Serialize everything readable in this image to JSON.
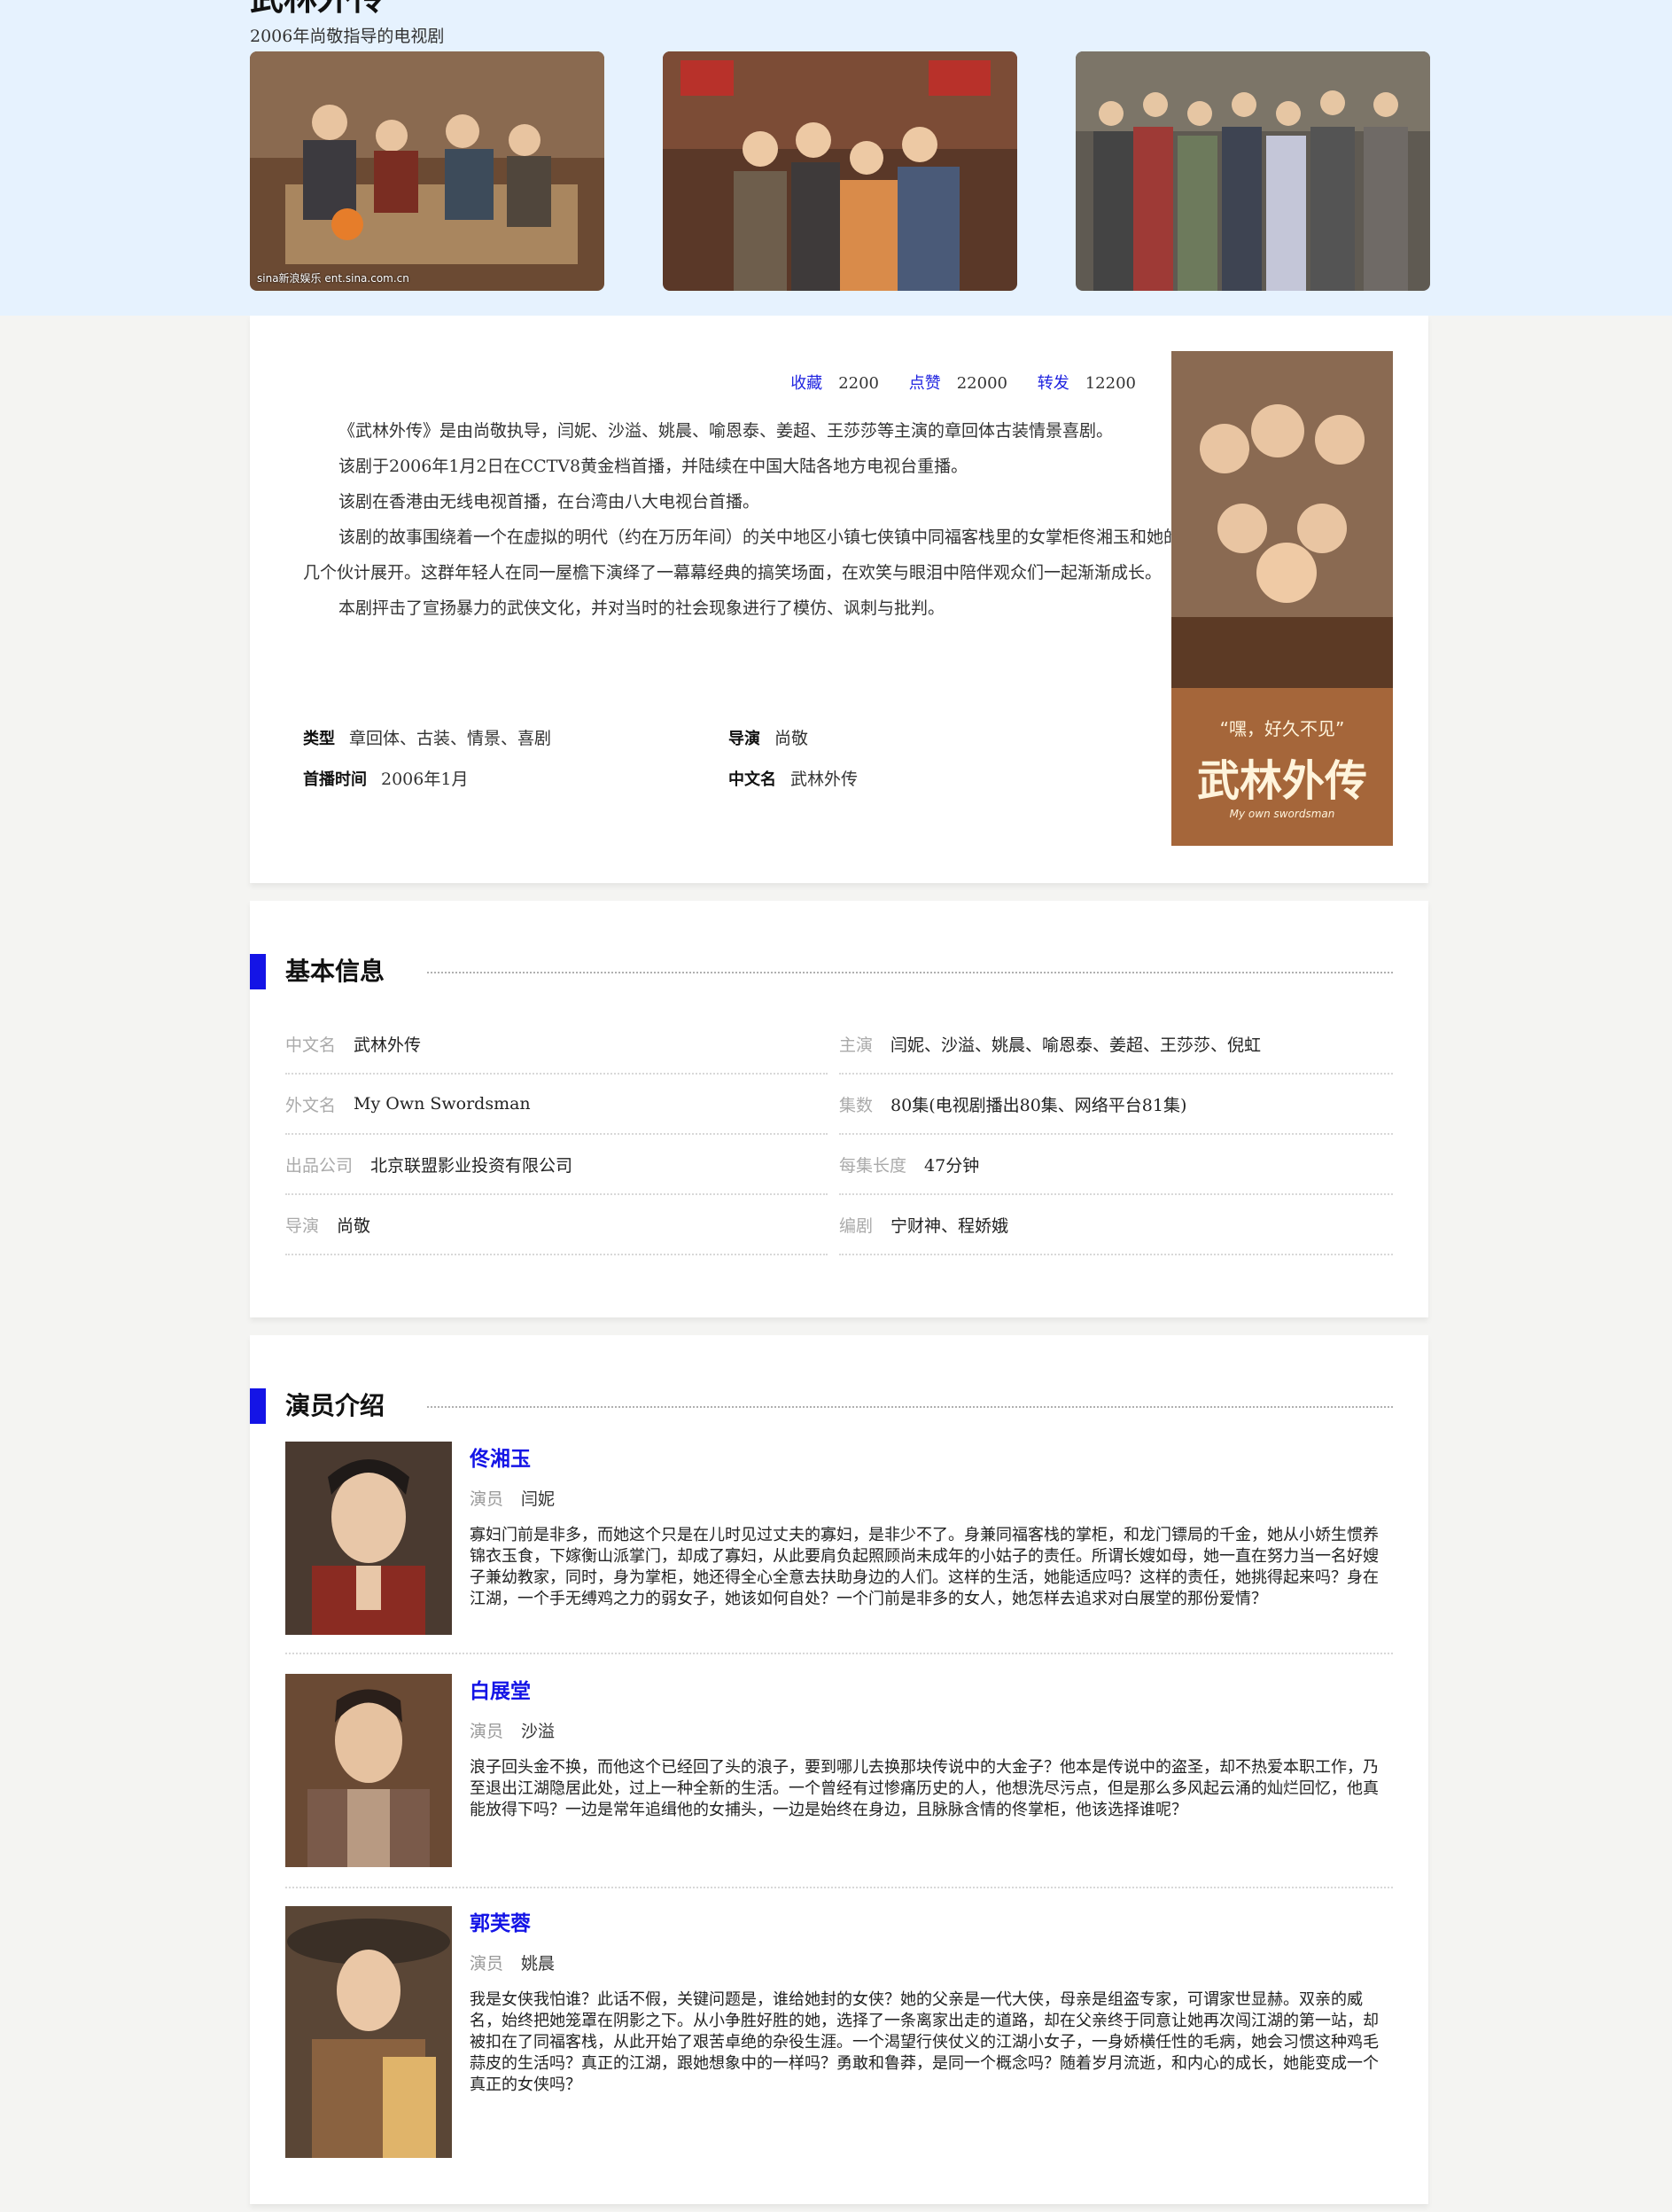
{
  "hero": {
    "title": "武林外传",
    "subtitle": "2006年尚敬指导的电视剧",
    "images": [
      {
        "caption": "sina新浪娱乐 ent.sina.com.cn"
      },
      {
        "caption": ""
      },
      {
        "caption": ""
      }
    ]
  },
  "summary": {
    "stats": [
      {
        "label": "收藏",
        "value": "2200"
      },
      {
        "label": "点赞",
        "value": "22000"
      },
      {
        "label": "转发",
        "value": "12200"
      }
    ],
    "paragraphs": [
      "《武林外传》是由尚敬执导，闫妮、沙溢、姚晨、喻恩泰、姜超、王莎莎等主演的章回体古装情景喜剧。",
      "该剧于2006年1月2日在CCTV8黄金档首播，并陆续在中国大陆各地方电视台重播。",
      "该剧在香港由无线电视首播，在台湾由八大电视台首播。",
      "该剧的故事围绕着一个在虚拟的明代（约在万历年间）的关中地区小镇七侠镇中同福客栈里的女掌柜佟湘玉和她的几个伙计展开。这群年轻人在同一屋檐下演绎了一幕幕经典的搞笑场面，在欢笑与眼泪中陪伴观众们一起渐渐成长。",
      "本剧抨击了宣扬暴力的武侠文化，并对当时的社会现象进行了模仿、讽刺与批判。"
    ],
    "facts": [
      {
        "key": "类型",
        "value": "章回体、古装、情景、喜剧"
      },
      {
        "key": "导演",
        "value": "尚敬"
      },
      {
        "key": "首播时间",
        "value": "2006年1月"
      },
      {
        "key": "中文名",
        "value": "武林外传"
      }
    ],
    "poster": {
      "tagline": "“嘿，好久不见”",
      "logo": "武林外传",
      "logo_en": "My own swordsman"
    }
  },
  "basic_info": {
    "title": "基本信息",
    "rows": [
      {
        "key": "中文名",
        "value": "武林外传"
      },
      {
        "key": "主演",
        "value": "闫妮、沙溢、姚晨、喻恩泰、姜超、王莎莎、倪虹"
      },
      {
        "key": "外文名",
        "value": "My Own Swordsman"
      },
      {
        "key": "集数",
        "value": "80集(电视剧播出80集、网络平台81集)"
      },
      {
        "key": "出品公司",
        "value": "北京联盟影业投资有限公司"
      },
      {
        "key": "每集长度",
        "value": "47分钟"
      },
      {
        "key": "导演",
        "value": "尚敬"
      },
      {
        "key": "编剧",
        "value": "宁财神、程娇娥"
      }
    ]
  },
  "cast": {
    "title": "演员介绍",
    "role_label": "演员",
    "actors": [
      {
        "character": "佟湘玉",
        "actor": "闫妮",
        "description": "寡妇门前是非多，而她这个只是在儿时见过丈夫的寡妇，是非少不了。身兼同福客栈的掌柜，和龙门镖局的千金，她从小娇生惯养锦衣玉食，下嫁衡山派掌门，却成了寡妇，从此要肩负起照顾尚未成年的小姑子的责任。所谓长嫂如母，她一直在努力当一名好嫂子兼幼教家，同时，身为掌柜，她还得全心全意去扶助身边的人们。这样的生活，她能适应吗？这样的责任，她挑得起来吗？身在江湖，一个手无缚鸡之力的弱女子，她该如何自处？一个门前是非多的女人，她怎样去追求对白展堂的那份爱情？"
      },
      {
        "character": "白展堂",
        "actor": "沙溢",
        "description": "浪子回头金不换，而他这个已经回了头的浪子，要到哪儿去换那块传说中的大金子？他本是传说中的盗圣，却不热爱本职工作，乃至退出江湖隐居此处，过上一种全新的生活。一个曾经有过惨痛历史的人，他想洗尽污点，但是那么多风起云涌的灿烂回忆，他真能放得下吗？一边是常年追缉他的女捕头，一边是始终在身边，且脉脉含情的佟掌柜，他该选择谁呢？"
      },
      {
        "character": "郭芙蓉",
        "actor": "姚晨",
        "description": "我是女侠我怕谁？此话不假，关键问题是，谁给她封的女侠？她的父亲是一代大侠，母亲是组盗专家，可谓家世显赫。双亲的威名，始终把她笼罩在阴影之下。从小争胜好胜的她，选择了一条离家出走的道路，却在父亲终于同意让她再次闯江湖的第一站，却被扣在了同福客栈，从此开始了艰苦卓绝的杂役生涯。一个渴望行侠仗义的江湖小女子，一身娇横任性的毛病，她会习惯这种鸡毛蒜皮的生活吗？真正的江湖，跟她想象中的一样吗？勇敢和鲁莽，是同一个概念吗？随着岁月流逝，和内心的成长，她能变成一个真正的女侠吗？"
      }
    ]
  }
}
